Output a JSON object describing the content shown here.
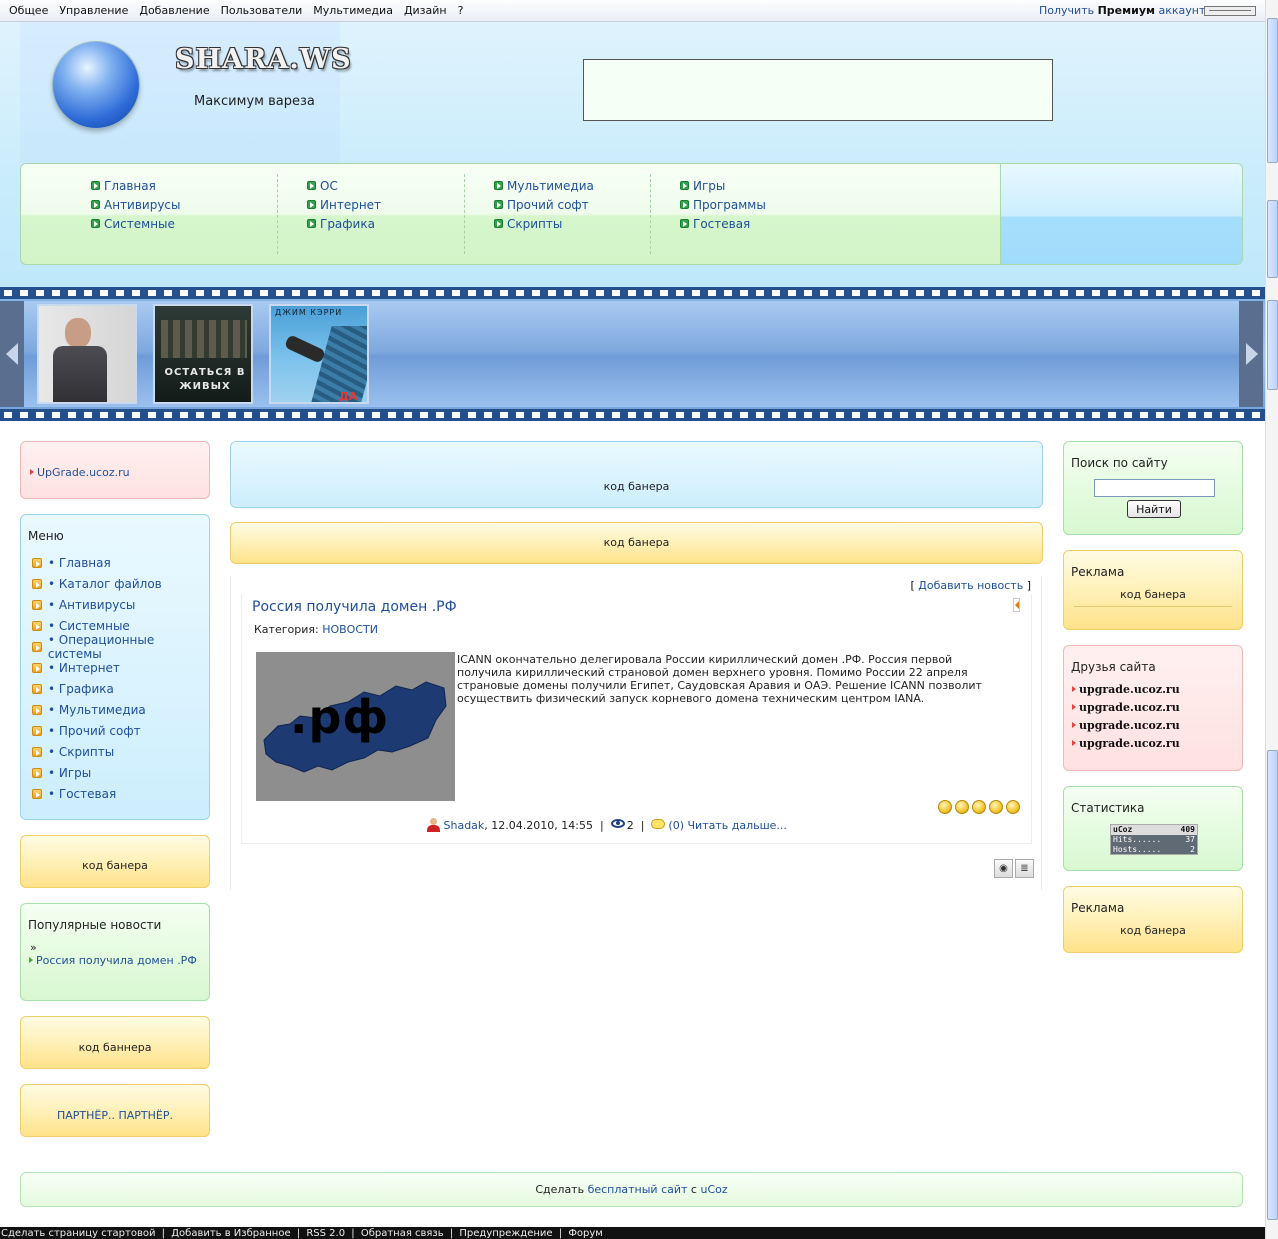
{
  "adminbar": {
    "menu": [
      "Общее",
      "Управление",
      "Добавление",
      "Пользователи",
      "Мультимедиа",
      "Дизайн",
      "?"
    ],
    "premium_prefix": "Получить",
    "premium_bold": "Премиум",
    "premium_suffix": "аккаунт"
  },
  "header": {
    "site_name": "SHARA.WS",
    "slogan": "Максимум вареза"
  },
  "nav": {
    "col1": [
      "Главная",
      "Антивирусы",
      "Системные"
    ],
    "col2": [
      "ОС",
      "Интернет",
      "Графика"
    ],
    "col3": [
      "Мультимедиа",
      "Прочий софт",
      "Скрипты"
    ],
    "col4": [
      "Игры",
      "Программы",
      "Гостевая"
    ]
  },
  "posters": {
    "p2_title": "ОСТАТЬСЯ В ЖИВЫХ",
    "p3_top": "ДЖИМ КЭРРИ",
    "p3_bottom": "ДА"
  },
  "left": {
    "upgrade_link": "UpGrade.ucoz.ru",
    "menu_title": "Меню",
    "menu_items": [
      "• Главная",
      "• Каталог файлов",
      "• Антивирусы",
      "• Системные",
      "• Операционные системы",
      "• Интернет",
      "• Графика",
      "• Мультимедиа",
      "• Прочий софт",
      "• Скрипты",
      "• Игры",
      "• Гостевая"
    ],
    "banner1": "код банера",
    "popular_title": "Популярные новости",
    "popular_bullet": "»",
    "popular_item": "Россия получила домен .РФ",
    "banner2": "код баннера",
    "partner": "ПАРТНЁР.. ПАРТНЁР."
  },
  "center": {
    "banner_blue": "код банера",
    "banner_yellow": "код банера",
    "add_news_open": "[",
    "add_news": "Добавить новость",
    "add_news_close": "]",
    "news": {
      "title": "Россия получила домен .РФ",
      "category_label": "Категория:",
      "category": "НОВОСТИ",
      "image_text": ".рф",
      "text": "ICANN окончательно делегировала России кириллический домен .РФ. Россия первой получила кириллический страновой домен верхнего уровня. Помимо России 22 апреля страновые домены получили Египет, Саудовская Аравия и ОАЭ. Решение ICANN позволит осуществить физический запуск корневого домена техническим центром IANA.",
      "author": "Shadak",
      "date": ", 12.04.2010, 14:55",
      "sep1": "|",
      "views": "2",
      "sep2": "|",
      "comments": "(0)",
      "read_more": "Читать дальше...",
      "rating_stars": 5
    }
  },
  "right": {
    "search_title": "Поиск по сайту",
    "search_button": "Найти",
    "ad1_title": "Реклама",
    "ad1_text": "код банера",
    "friends_title": "Друзья сайта",
    "friends": [
      "upgrade.ucoz.ru",
      "upgrade.ucoz.ru",
      "upgrade.ucoz.ru",
      "upgrade.ucoz.ru"
    ],
    "stats_title": "Статистика",
    "counter": {
      "brand": "uCoz",
      "total": "409",
      "hits_label": "Hits......",
      "hits": "37",
      "hosts_label": "Hosts.....",
      "hosts": "2"
    },
    "ad2_title": "Реклама",
    "ad2_text": "код банера"
  },
  "footer": {
    "prefix": "Сделать",
    "link": "бесплатный сайт",
    "mid": "с",
    "brand": "uCoz"
  },
  "bottom_bar": [
    "Сделать страницу стартовой",
    "|",
    "Добавить в Избранное",
    "|",
    "RSS 2.0",
    "|",
    "Обратная связь",
    "|",
    "Предупреждение",
    "|",
    "Форум"
  ],
  "colors": {
    "link": "#1f4f9a",
    "nav_bullet": "#33a34b",
    "banner_yellow": "#ffe28a",
    "banner_blue": "#cdeefd"
  }
}
